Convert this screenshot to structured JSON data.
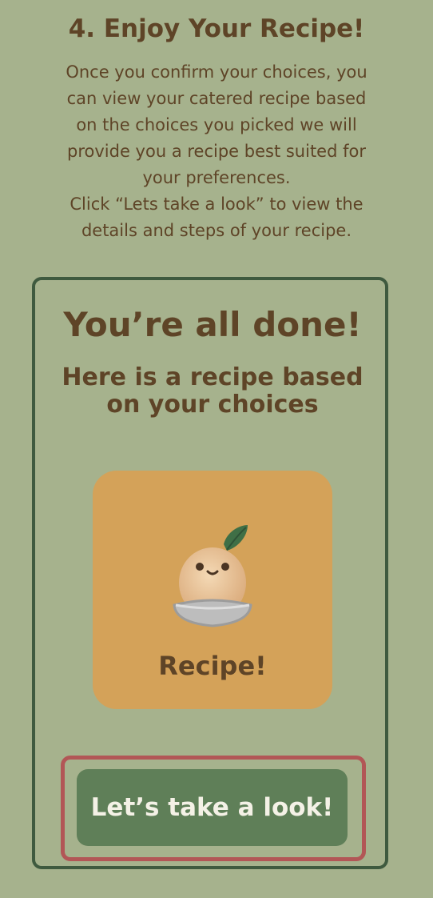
{
  "step": {
    "title": "4. Enjoy Your Recipe!",
    "description": "Once you confirm your choices, you\ncan view your catered recipe based\non the choices you picked we will\nprovide you a recipe best suited for\nyour preferences.\nClick “Lets take a look” to view the\ndetails and steps of your recipe."
  },
  "done": {
    "title": "You’re all done!",
    "subtitle": "Here is a recipe based\non your choices"
  },
  "recipe_card": {
    "label": "Recipe!",
    "icon": "potato-in-bowl-icon"
  },
  "cta": {
    "label": "Let’s take a look!"
  },
  "colors": {
    "background": "#a6b28d",
    "text": "#5e4427",
    "card_border": "#3f5a3f",
    "tile": "#d4a259",
    "button": "#5f7f58",
    "highlight": "#b25656"
  }
}
